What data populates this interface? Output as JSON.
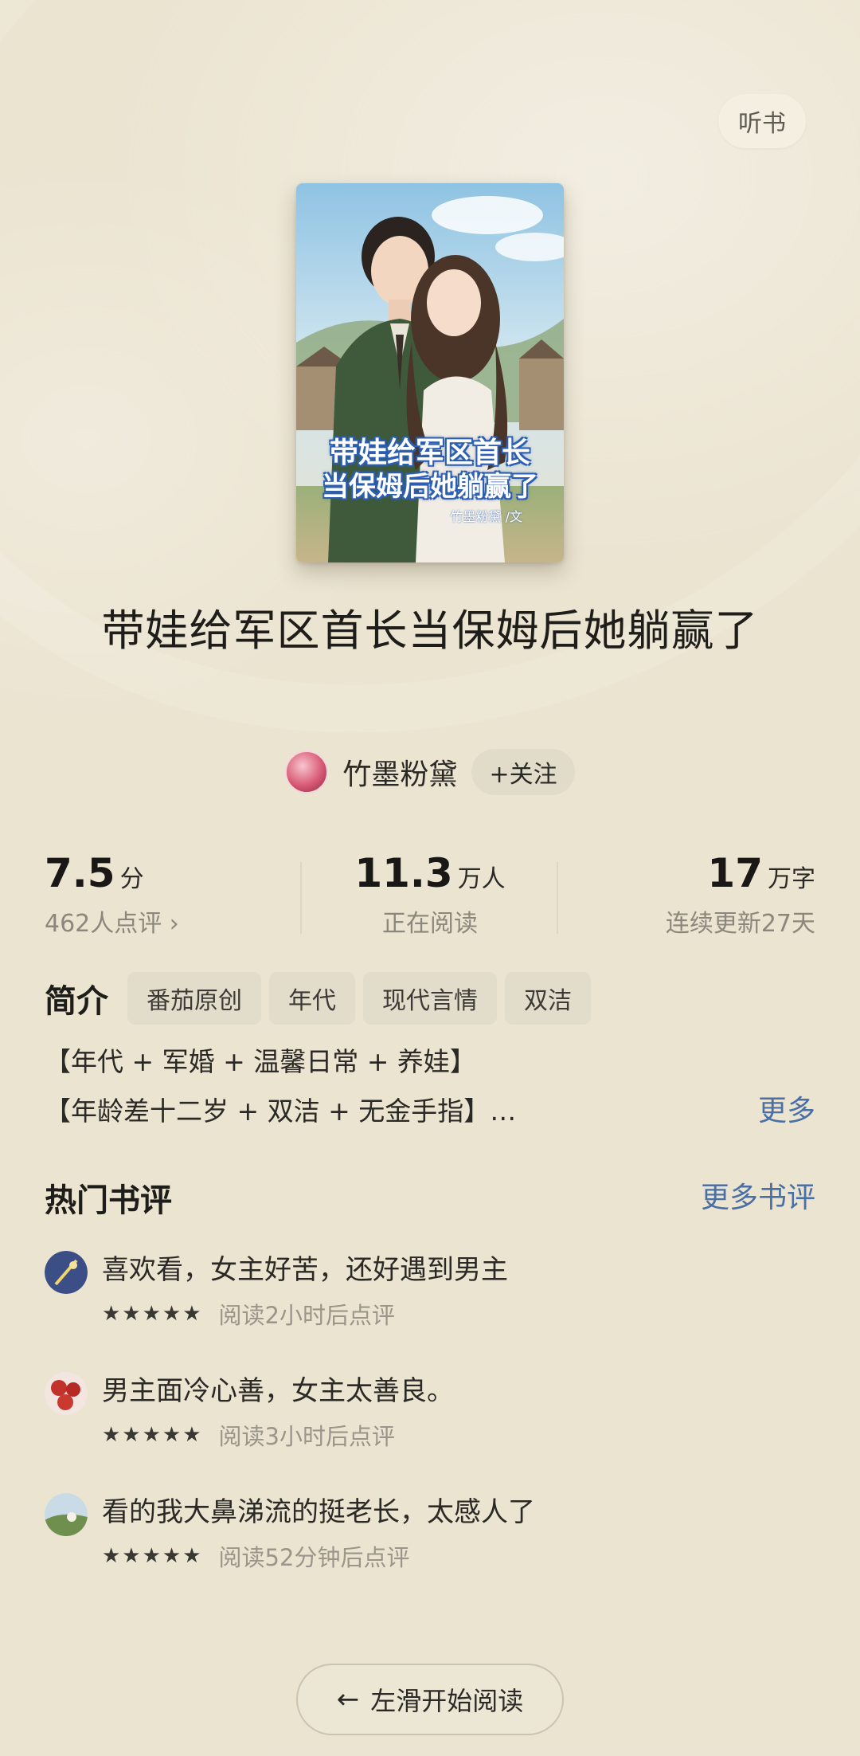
{
  "header": {
    "listen_label": "听书"
  },
  "cover": {
    "title_line1": "带娃给军区首长",
    "title_line2": "当保姆后她躺赢了",
    "author_tag": "竹墨粉黛 /文"
  },
  "book": {
    "title": "带娃给军区首长当保姆后她躺赢了",
    "author": "竹墨粉黛",
    "follow_label": "+关注"
  },
  "stats": [
    {
      "value": "7.5",
      "unit": "分",
      "label": "462人点评 ›"
    },
    {
      "value": "11.3",
      "unit": "万人",
      "label": "正在阅读"
    },
    {
      "value": "17",
      "unit": "万字",
      "label": "连续更新27天"
    }
  ],
  "intro": {
    "heading": "简介",
    "tags": [
      "番茄原创",
      "年代",
      "现代言情",
      "双洁"
    ],
    "line1": "【年代 + 军婚 + 温馨日常 + 养娃】",
    "line2": "【年龄差十二岁 + 双洁 + 无金手指】…",
    "more_label": "更多"
  },
  "reviews_section": {
    "heading": "热门书评",
    "more_label": "更多书评",
    "items": [
      {
        "text": "喜欢看，女主好苦，还好遇到男主",
        "stars": "★★★★★",
        "time": "阅读2小时后点评"
      },
      {
        "text": "男主面冷心善，女主太善良。",
        "stars": "★★★★★",
        "time": "阅读3小时后点评"
      },
      {
        "text": "看的我大鼻涕流的挺老长，太感人了",
        "stars": "★★★★★",
        "time": "阅读52分钟后点评"
      }
    ]
  },
  "footer": {
    "start_label": "左滑开始阅读",
    "arrow_icon": "arrow-left-icon"
  }
}
